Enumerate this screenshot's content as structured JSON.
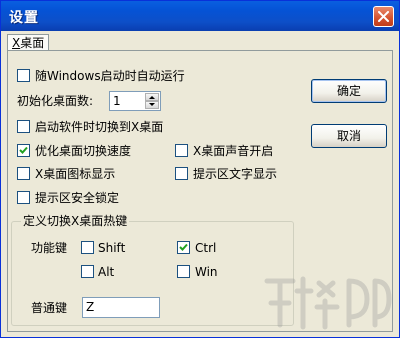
{
  "window": {
    "title": "设置"
  },
  "tabs": [
    {
      "label_pre": "X",
      "label_rest": "桌面"
    }
  ],
  "options": {
    "run_on_startup": {
      "label": "随Windows启动时自动运行",
      "checked": false
    },
    "init_desktop_count": {
      "label": "初始化桌面数:",
      "value": "1"
    },
    "switch_on_launch": {
      "label": "启动软件时切换到X桌面",
      "checked": false
    },
    "optimize_speed": {
      "label": "优化桌面切换速度",
      "checked": true
    },
    "sound_on": {
      "label": "X桌面声音开启",
      "checked": false
    },
    "icon_display": {
      "label": "X桌面图标显示",
      "checked": false
    },
    "tray_text": {
      "label": "提示区文字显示",
      "checked": false
    },
    "tray_lock": {
      "label": "提示区安全锁定",
      "checked": false
    }
  },
  "hotkey": {
    "group_title": "定义切换X桌面热键",
    "modifier_label": "功能键",
    "shift": {
      "label": "Shift",
      "checked": false
    },
    "ctrl": {
      "label": "Ctrl",
      "checked": true
    },
    "alt": {
      "label": "Alt",
      "checked": false
    },
    "win": {
      "label": "Win",
      "checked": false
    },
    "normal_label": "普通键",
    "normal_value": "Z"
  },
  "buttons": {
    "ok": "确定",
    "cancel": "取消"
  },
  "colors": {
    "titlebar": "#0553d6",
    "close": "#d4522e",
    "face": "#ece9d8"
  }
}
